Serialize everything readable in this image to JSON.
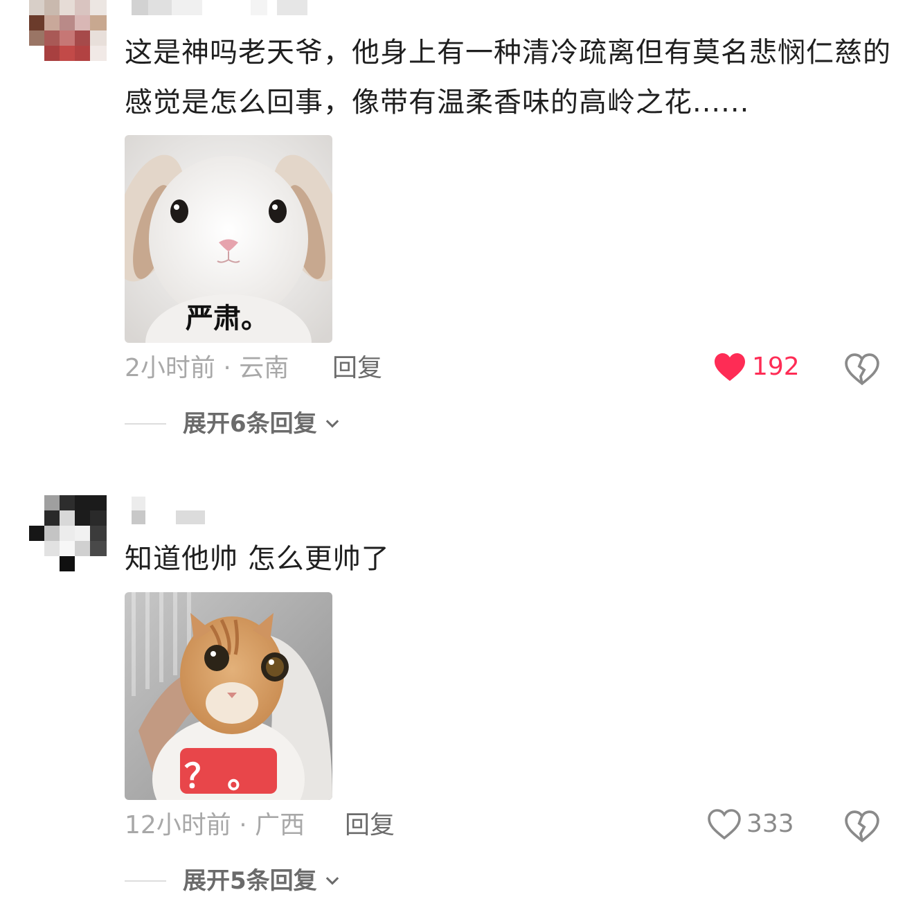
{
  "comments": [
    {
      "text": "这是神吗老天爷，他身上有一种清冷疏离但有莫名悲悯仁慈的感觉是怎么回事，像带有温柔香味的高岭之花......",
      "sticker_caption": "严肃。",
      "time": "2小时前",
      "separator": "·",
      "location": "云南",
      "reply_label": "回复",
      "like_count": "192",
      "liked": true,
      "expand_label": "展开6条回复"
    },
    {
      "text": "知道他帅 怎么更帅了",
      "sticker_caption": "？。",
      "time": "12小时前",
      "separator": "·",
      "location": "广西",
      "reply_label": "回复",
      "like_count": "333",
      "liked": false,
      "expand_label": "展开5条回复"
    }
  ],
  "colors": {
    "like_active": "#fe2c55",
    "meta_gray": "#a8a8a8",
    "text_dark": "#1f1f1f"
  },
  "icons": {
    "like": "heart-icon",
    "dislike": "broken-heart-icon",
    "expand": "chevron-down-icon"
  }
}
